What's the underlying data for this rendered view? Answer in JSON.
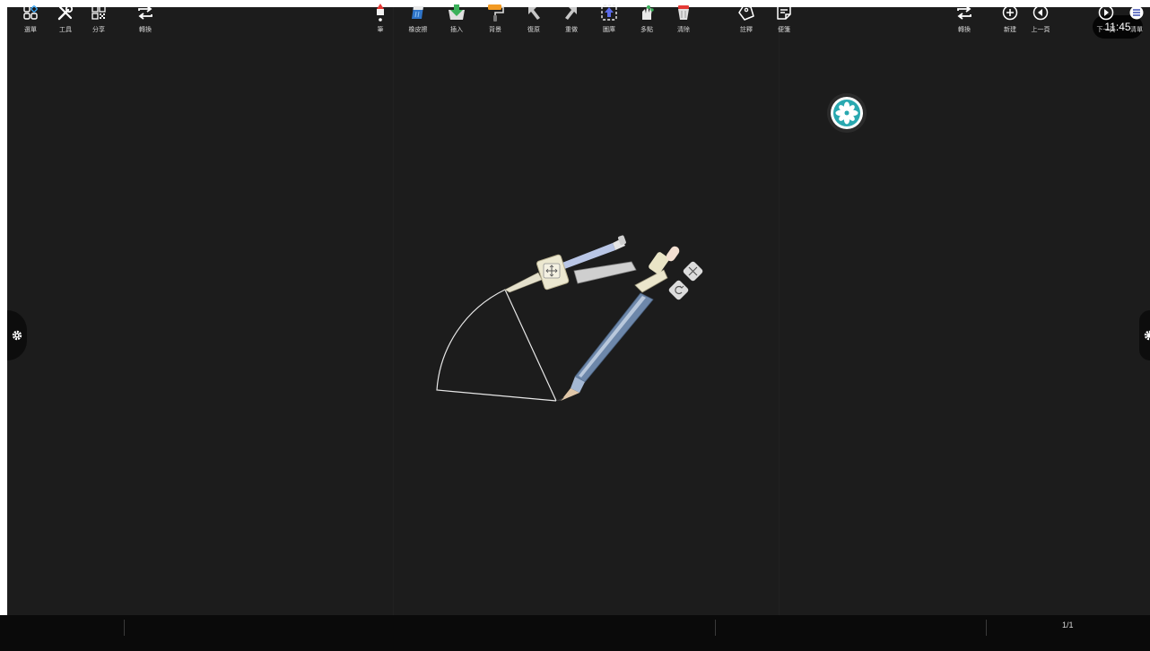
{
  "status": {
    "time": "11:45"
  },
  "toolbar": {
    "left": [
      {
        "label": "選單",
        "icon": "menu-grid-icon"
      },
      {
        "label": "工具",
        "icon": "tools-icon"
      },
      {
        "label": "分享",
        "icon": "qr-code-icon"
      },
      {
        "label": "轉換",
        "icon": "switch-icon"
      }
    ],
    "center": [
      {
        "label": "筆",
        "icon": "pen-icon"
      },
      {
        "label": "橡皮擦",
        "icon": "eraser-icon"
      },
      {
        "label": "插入",
        "icon": "insert-icon"
      },
      {
        "label": "背景",
        "icon": "paint-roller-icon"
      },
      {
        "label": "復原",
        "icon": "undo-icon"
      },
      {
        "label": "重做",
        "icon": "redo-icon"
      },
      {
        "label": "圖庫",
        "icon": "gallery-icon"
      },
      {
        "label": "多點",
        "icon": "multi-touch-icon"
      },
      {
        "label": "清除",
        "icon": "trash-icon"
      },
      {
        "label": "註釋",
        "icon": "tag-icon"
      },
      {
        "label": "便箋",
        "icon": "sticky-note-icon"
      }
    ],
    "right": [
      {
        "label": "轉換",
        "icon": "switch-icon"
      },
      {
        "label": "新建",
        "icon": "add-page-icon"
      },
      {
        "label": "上一頁",
        "icon": "previous-page-icon"
      },
      {
        "label": "下一頁",
        "icon": "next-page-icon"
      },
      {
        "label": "清單",
        "icon": "page-list-icon"
      }
    ],
    "page_indicator": "1/1"
  },
  "colors": {
    "board": "#1c1c1c",
    "toolbar": "#0a0a0a",
    "accent": "#29a8b0"
  }
}
